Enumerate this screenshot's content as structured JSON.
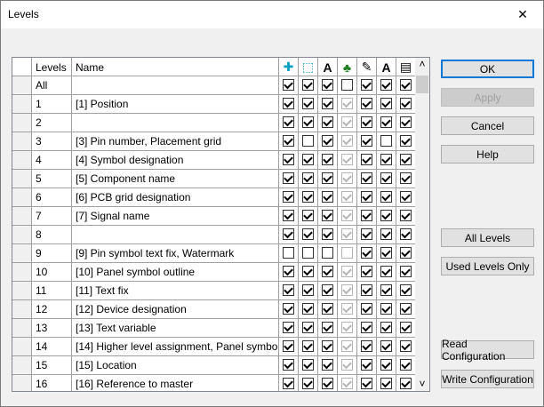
{
  "window": {
    "title": "Levels",
    "close_glyph": "✕"
  },
  "table": {
    "headers": {
      "levels": "Levels",
      "name": "Name"
    },
    "column_icons": [
      "visible-icon",
      "plot-icon",
      "text-visible-icon",
      "tree-icon",
      "pen-icon",
      "font-icon",
      "layer-icon"
    ],
    "icon_glyphs": [
      "✚",
      "⬚",
      "A",
      "♣",
      "✎",
      "A",
      "▤"
    ],
    "icon_colors": {
      "primary": "#00a0c0",
      "green": "#208020",
      "dark": "#000000"
    },
    "rows": [
      {
        "level": "All",
        "name": "",
        "checks": [
          1,
          1,
          1,
          0,
          1,
          1,
          1
        ],
        "disabled": [
          0,
          0,
          0,
          0,
          0,
          0,
          0
        ]
      },
      {
        "level": "1",
        "name": "[1] Position",
        "checks": [
          1,
          1,
          1,
          1,
          1,
          1,
          1
        ],
        "disabled": [
          0,
          0,
          0,
          1,
          0,
          0,
          0
        ]
      },
      {
        "level": "2",
        "name": "",
        "checks": [
          1,
          1,
          1,
          1,
          1,
          1,
          1
        ],
        "disabled": [
          0,
          0,
          0,
          1,
          0,
          0,
          0
        ]
      },
      {
        "level": "3",
        "name": "[3] Pin number, Placement grid",
        "checks": [
          1,
          0,
          1,
          1,
          1,
          0,
          1
        ],
        "disabled": [
          0,
          0,
          0,
          1,
          0,
          0,
          0
        ]
      },
      {
        "level": "4",
        "name": "[4] Symbol designation",
        "checks": [
          1,
          1,
          1,
          1,
          1,
          1,
          1
        ],
        "disabled": [
          0,
          0,
          0,
          1,
          0,
          0,
          0
        ]
      },
      {
        "level": "5",
        "name": "[5] Component name",
        "checks": [
          1,
          1,
          1,
          1,
          1,
          1,
          1
        ],
        "disabled": [
          0,
          0,
          0,
          1,
          0,
          0,
          0
        ]
      },
      {
        "level": "6",
        "name": "[6] PCB grid designation",
        "checks": [
          1,
          1,
          1,
          1,
          1,
          1,
          1
        ],
        "disabled": [
          0,
          0,
          0,
          1,
          0,
          0,
          0
        ]
      },
      {
        "level": "7",
        "name": "[7] Signal name",
        "checks": [
          1,
          1,
          1,
          1,
          1,
          1,
          1
        ],
        "disabled": [
          0,
          0,
          0,
          1,
          0,
          0,
          0
        ]
      },
      {
        "level": "8",
        "name": "",
        "checks": [
          1,
          1,
          1,
          1,
          1,
          1,
          1
        ],
        "disabled": [
          0,
          0,
          0,
          1,
          0,
          0,
          0
        ]
      },
      {
        "level": "9",
        "name": "[9] Pin symbol text fix, Watermark",
        "checks": [
          0,
          0,
          0,
          0,
          1,
          1,
          1
        ],
        "disabled": [
          0,
          0,
          0,
          1,
          0,
          0,
          0
        ]
      },
      {
        "level": "10",
        "name": "[10] Panel symbol outline",
        "checks": [
          1,
          1,
          1,
          1,
          1,
          1,
          1
        ],
        "disabled": [
          0,
          0,
          0,
          1,
          0,
          0,
          0
        ]
      },
      {
        "level": "11",
        "name": "[11] Text fix",
        "checks": [
          1,
          1,
          1,
          1,
          1,
          1,
          1
        ],
        "disabled": [
          0,
          0,
          0,
          1,
          0,
          0,
          0
        ]
      },
      {
        "level": "12",
        "name": "[12] Device designation",
        "checks": [
          1,
          1,
          1,
          1,
          1,
          1,
          1
        ],
        "disabled": [
          0,
          0,
          0,
          1,
          0,
          0,
          0
        ]
      },
      {
        "level": "13",
        "name": "[13] Text variable",
        "checks": [
          1,
          1,
          1,
          1,
          1,
          1,
          1
        ],
        "disabled": [
          0,
          0,
          0,
          1,
          0,
          0,
          0
        ]
      },
      {
        "level": "14",
        "name": "[14] Higher level assignment, Panel symbo",
        "checks": [
          1,
          1,
          1,
          1,
          1,
          1,
          1
        ],
        "disabled": [
          0,
          0,
          0,
          1,
          0,
          0,
          0
        ]
      },
      {
        "level": "15",
        "name": "[15] Location",
        "checks": [
          1,
          1,
          1,
          1,
          1,
          1,
          1
        ],
        "disabled": [
          0,
          0,
          0,
          1,
          0,
          0,
          0
        ]
      },
      {
        "level": "16",
        "name": "[16] Reference to master",
        "checks": [
          1,
          1,
          1,
          1,
          1,
          1,
          1
        ],
        "disabled": [
          0,
          0,
          0,
          1,
          0,
          0,
          0
        ]
      }
    ],
    "scroll": {
      "up": "˄",
      "down": "˅"
    }
  },
  "buttons": {
    "ok": "OK",
    "apply": "Apply",
    "cancel": "Cancel",
    "help": "Help",
    "all_levels": "All Levels",
    "used_levels_only": "Used Levels Only",
    "read_configuration": "Read Configuration",
    "write_configuration": "Write Configuration"
  }
}
